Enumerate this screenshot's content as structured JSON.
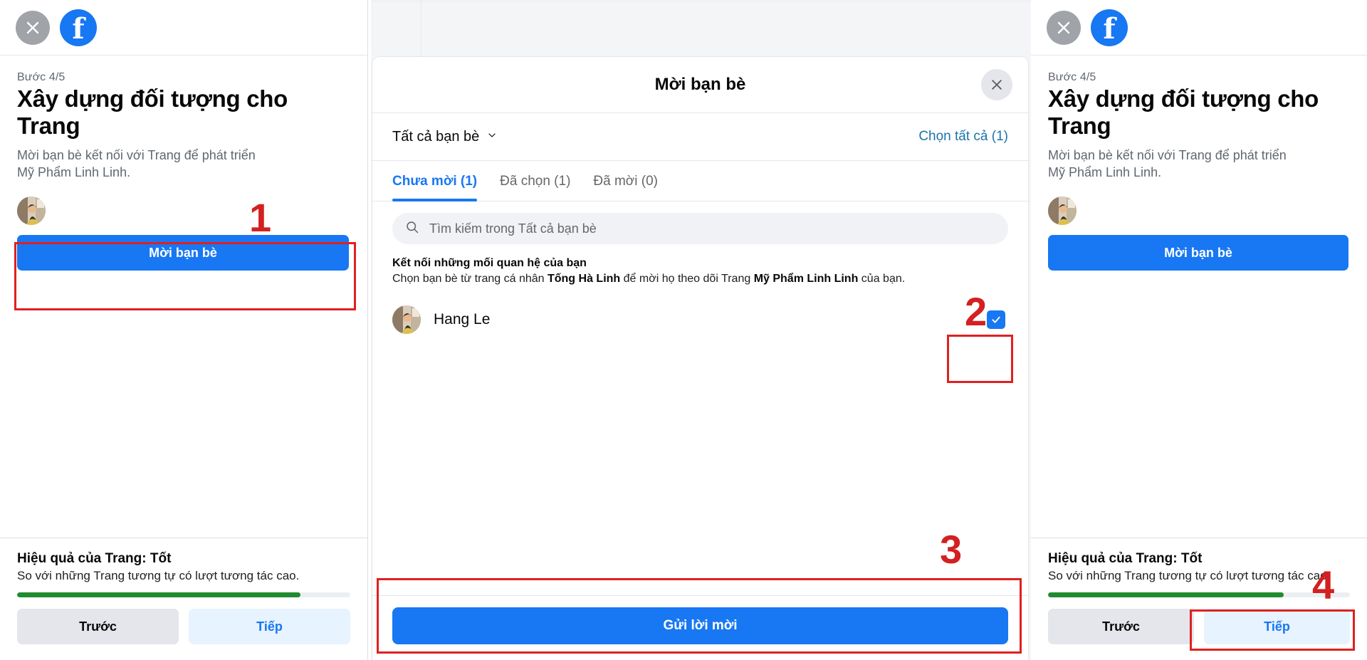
{
  "colors": {
    "fb_blue": "#1877f2",
    "annotation_red": "#e02020",
    "progress_green": "#208b2f",
    "link_blue": "#1b74a8",
    "grey_btn": "#e4e6eb",
    "lightblue_btn": "#e7f3ff"
  },
  "left_panel": {
    "close_icon": "close-icon",
    "brand_icon": "facebook-logo",
    "brand_letter": "f",
    "step": "Bước 4/5",
    "title": "Xây dựng đối tượng cho Trang",
    "subtitle_line1": "Mời bạn bè kết nối với Trang để phát triển",
    "subtitle_line2": "Mỹ Phẩm Linh Linh.",
    "avatar_name": "page-avatar",
    "invite_button": "Mời bạn bè",
    "footer": {
      "perf_title": "Hiệu quả của Trang: Tốt",
      "perf_sub_line1": "So với những Trang tương tự có lượt tương tác",
      "perf_sub_line2": "cao.",
      "progress_percent": 85,
      "back_button": "Trước",
      "next_button": "Tiếp"
    }
  },
  "modal": {
    "title": "Mời bạn bè",
    "close_icon": "close-icon",
    "filter_label": "Tất cả bạn bè",
    "filter_chevron": "chevron-down-icon",
    "select_all": "Chọn tất cả (1)",
    "tabs": [
      {
        "label": "Chưa mời (1)",
        "active": true
      },
      {
        "label": "Đã chọn (1)",
        "active": false
      },
      {
        "label": "Đã mời (0)",
        "active": false
      }
    ],
    "search": {
      "icon": "search-icon",
      "placeholder": "Tìm kiếm trong Tất cả bạn bè",
      "value": ""
    },
    "connection": {
      "title": "Kết nối những mối quan hệ của bạn",
      "desc_part1": "Chọn bạn bè từ trang cá nhân ",
      "desc_bold1": "Tống Hà Linh",
      "desc_part2": " để mời họ theo dõi Trang ",
      "desc_bold2": "Mỹ Phẩm Linh Linh",
      "desc_part3": " của bạn."
    },
    "friends": [
      {
        "name": "Hang Le",
        "checked": true,
        "check_icon": "checkmark-icon"
      }
    ],
    "send_button": "Gửi lời mời"
  },
  "right_panel": {
    "close_icon": "close-icon",
    "brand_icon": "facebook-logo",
    "brand_letter": "f",
    "step": "Bước 4/5",
    "title": "Xây dựng đối tượng cho Trang",
    "subtitle_line1": "Mời bạn bè kết nối với Trang để phát triển",
    "subtitle_line2": "Mỹ Phẩm Linh Linh.",
    "avatar_name": "page-avatar",
    "invite_button": "Mời bạn bè",
    "footer": {
      "perf_title": "Hiệu quả của Trang: Tốt",
      "perf_sub_line1": "So với những Trang tương tự có lượt tương tác",
      "perf_sub_line2": "cao.",
      "progress_percent": 78,
      "back_button": "Trước",
      "next_button": "Tiếp"
    }
  },
  "annotations": [
    {
      "number": "1",
      "target": "invite-friends-button-left"
    },
    {
      "number": "2",
      "target": "friend-checkbox"
    },
    {
      "number": "3",
      "target": "send-invites-button"
    },
    {
      "number": "4",
      "target": "next-button-right"
    }
  ]
}
